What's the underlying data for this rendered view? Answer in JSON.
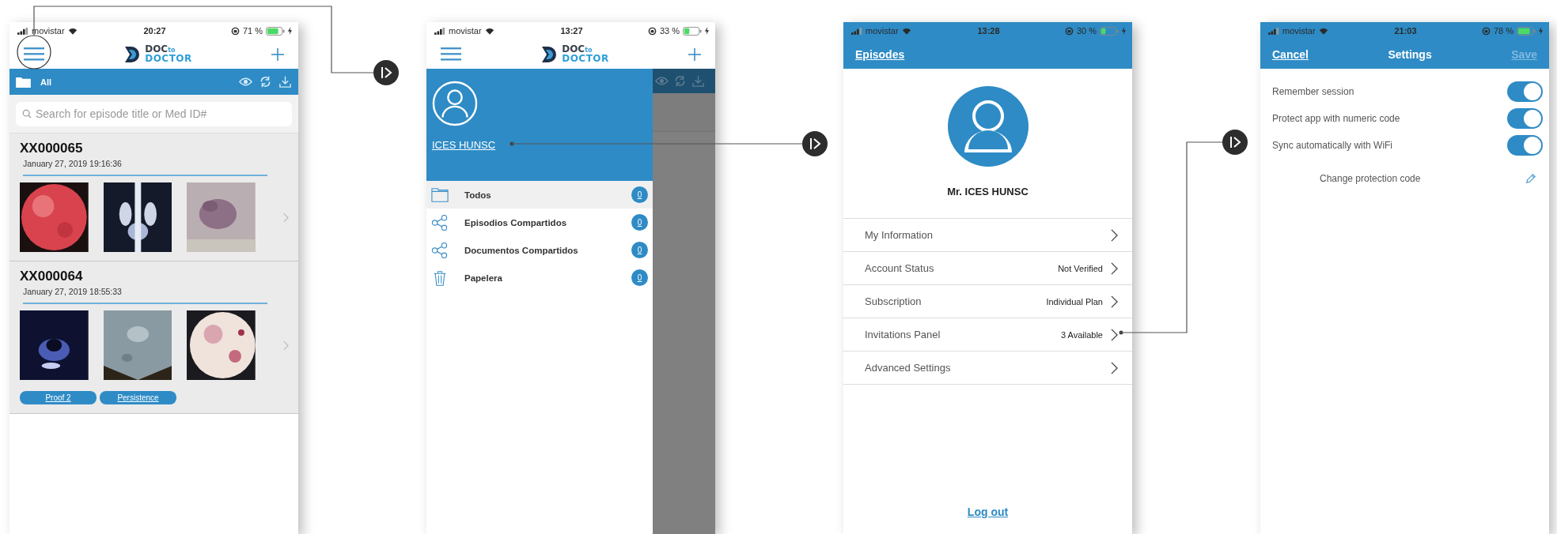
{
  "screens": [
    {
      "kind": "episodes",
      "status_bar": {
        "carrier": "movistar",
        "time": "20:27",
        "battery": "71 %"
      },
      "logo": {
        "top": "DOC",
        "small": "to",
        "bottom": "DOCTOR"
      },
      "folder_bar": {
        "label": "All"
      },
      "search": {
        "placeholder": "Search for episode title or Med ID#"
      },
      "episodes": [
        {
          "title": "XX000065",
          "date": "January 27, 2019 19:16:36",
          "images": [
            {
              "kind": "picture"
            },
            {
              "kind": "picture"
            },
            {
              "kind": "picture"
            }
          ]
        },
        {
          "title": "XX000064",
          "date": "January 27, 2019 18:55:33",
          "images": [
            {
              "kind": "picture"
            },
            {
              "kind": "picture"
            },
            {
              "kind": "picture"
            }
          ],
          "tags": [
            "Proof 2",
            "Persistence"
          ]
        }
      ]
    },
    {
      "kind": "drawer",
      "status_bar": {
        "carrier": "movistar",
        "time": "13:27",
        "battery": "33 %"
      },
      "logo": {
        "top": "DOC",
        "small": "to",
        "bottom": "DOCTOR"
      },
      "profile": {
        "name": "ICES HUNSC"
      },
      "menu": [
        {
          "label": "Todos",
          "count": "0",
          "selected": true
        },
        {
          "label": "Episodios Compartidos",
          "count": "0",
          "selected": false
        },
        {
          "label": "Documentos Compartidos",
          "count": "0",
          "selected": false
        },
        {
          "label": "Papelera",
          "count": "0",
          "selected": false
        }
      ]
    },
    {
      "kind": "account",
      "status_bar": {
        "carrier": "movistar",
        "time": "13:28",
        "battery": "30 %"
      },
      "back_link": "Episodes",
      "name": "Mr. ICES HUNSC",
      "rows": [
        {
          "label": "My Information"
        },
        {
          "label": "Account Status",
          "value": "Not Verified"
        },
        {
          "label": "Subscription",
          "value": "Individual Plan"
        },
        {
          "label": "Invitations Panel",
          "value": "3 Available"
        },
        {
          "label": "Advanced Settings"
        }
      ],
      "logout": "Log out"
    },
    {
      "kind": "settings",
      "status_bar": {
        "carrier": "movistar",
        "time": "21:03",
        "battery": "78 %"
      },
      "cancel": "Cancel",
      "title": "Settings",
      "save": {
        "label": "Save",
        "disabled": true
      },
      "toggles": [
        {
          "label": "Remember session",
          "on": true
        },
        {
          "label": "Protect app with numeric code",
          "on": true
        },
        {
          "label": "Sync automatically with WiFi",
          "on": true
        }
      ],
      "change_code": "Change protection code"
    }
  ]
}
